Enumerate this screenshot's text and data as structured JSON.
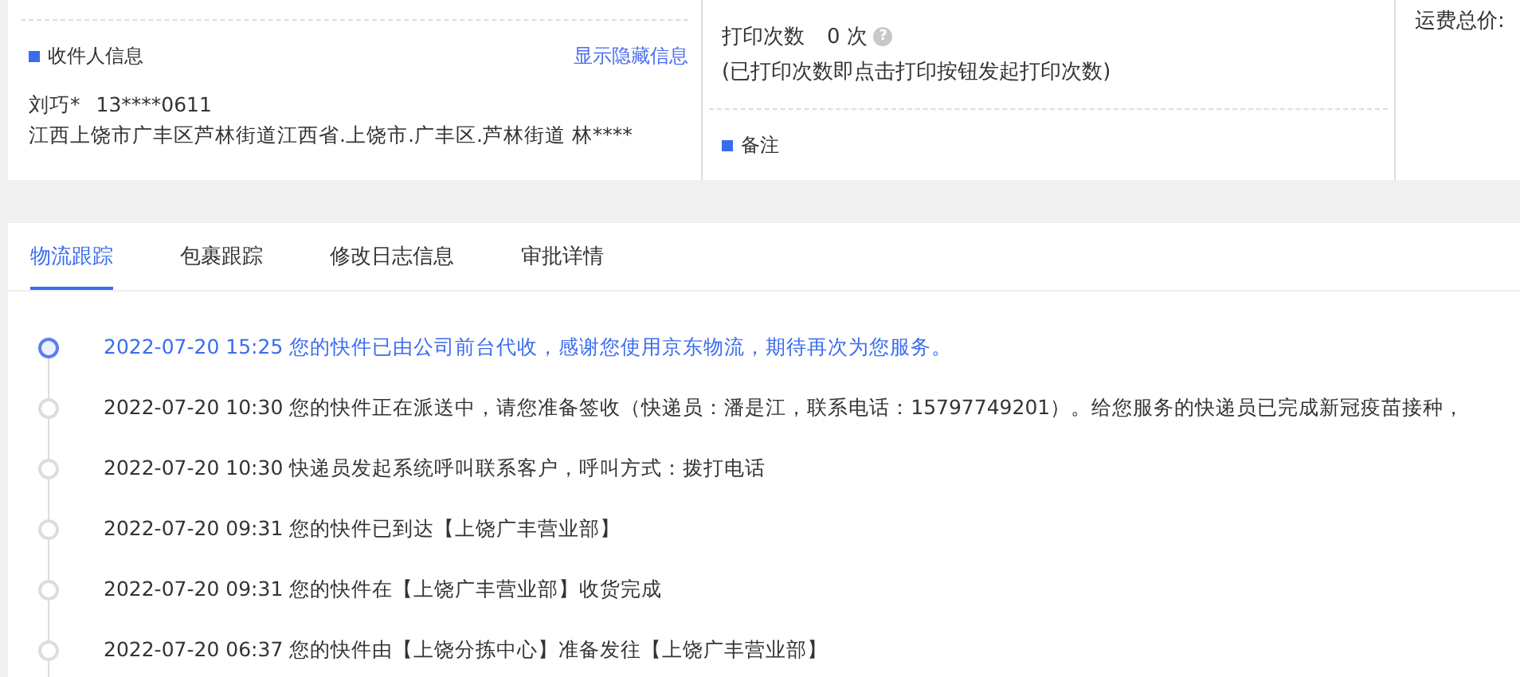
{
  "recipient": {
    "title": "收件人信息",
    "toggle_link": "显示隐藏信息",
    "name": "刘巧*",
    "phone": "13****0611",
    "address": "江西上饶市广丰区芦林街道江西省.上饶市.广丰区.芦林街道 林****"
  },
  "print": {
    "label": "打印次数",
    "count": "0 次",
    "help": "?",
    "note": "(已打印次数即点击打印按钮发起打印次数)"
  },
  "remark": {
    "title": "备注"
  },
  "freight": {
    "label": "运费总价:"
  },
  "tabs": [
    {
      "label": "物流跟踪",
      "selected": true
    },
    {
      "label": "包裹跟踪",
      "selected": false
    },
    {
      "label": "修改日志信息",
      "selected": false
    },
    {
      "label": "审批详情",
      "selected": false
    }
  ],
  "timeline": [
    {
      "time": "2022-07-20 15:25",
      "text": "您的快件已由公司前台代收，感谢您使用京东物流，期待再次为您服务。",
      "current": true
    },
    {
      "time": "2022-07-20 10:30",
      "text": "您的快件正在派送中，请您准备签收（快递员：潘是江，联系电话：15797749201）。给您服务的快递员已完成新冠疫苗接种，",
      "current": false
    },
    {
      "time": "2022-07-20 10:30",
      "text": "快递员发起系统呼叫联系客户，呼叫方式：拨打电话",
      "current": false
    },
    {
      "time": "2022-07-20 09:31",
      "text": "您的快件已到达【上饶广丰营业部】",
      "current": false
    },
    {
      "time": "2022-07-20 09:31",
      "text": "您的快件在【上饶广丰营业部】收货完成",
      "current": false
    },
    {
      "time": "2022-07-20 06:37",
      "text": "您的快件由【上饶分拣中心】准备发往【上饶广丰营业部】",
      "current": false
    }
  ]
}
